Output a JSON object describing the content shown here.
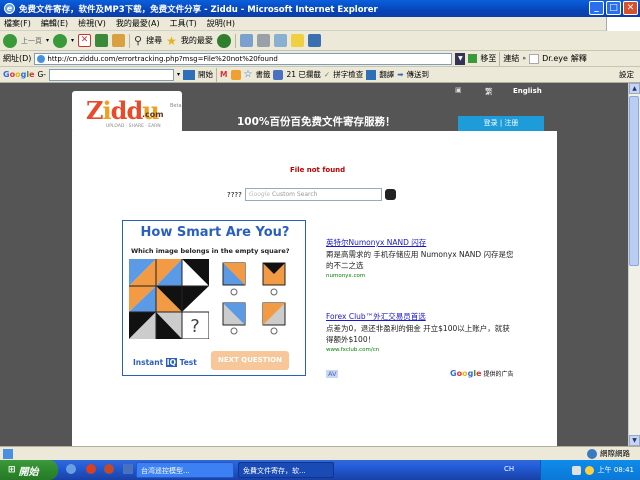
{
  "window": {
    "title": "免费文件寄存，软件及MP3下载，免费文件分享 - Ziddu - Microsoft Internet Explorer"
  },
  "menu": [
    "檔案(F)",
    "編輯(E)",
    "檢視(V)",
    "我的最愛(A)",
    "工具(T)",
    "說明(H)"
  ],
  "toolbar": {
    "back": "上一頁",
    "search": "搜尋",
    "favorites": "我的最愛"
  },
  "address": {
    "label": "網址(D)",
    "url": "http://cn.ziddu.com/errortracking.php?msg=File%20not%20found",
    "go": "移至",
    "links": "連結",
    "extra": "Dr.eye",
    "translate": "解釋"
  },
  "googlebar": {
    "logo": "Google",
    "search_label": "G-",
    "go": "開始",
    "bookmarks": "書籤",
    "blocked": "21 已攔截",
    "spellcheck": "拼字檢查",
    "translate": "翻譯",
    "sendto": "傳送到",
    "settings": "設定"
  },
  "site": {
    "lang": [
      "繁",
      "English"
    ],
    "logo_text": "Ziddu",
    "logo_beta": "Beta",
    "logo_com": ".com",
    "logo_tagline": "UPLOAD · SHARE · EARN",
    "headline": "100%百份百免费文件寄存服務！",
    "login": "登录 | 注册",
    "error": "File not found",
    "search_q": "????",
    "search_placeholder": "Custom Search",
    "search_brand": "Google"
  },
  "quiz_ad": {
    "title": "How Smart Are You?",
    "question": "Which image belongs in the empty square?",
    "brand_left": "Instant",
    "brand_iq": "IQ",
    "brand_right": "Test",
    "button": "NEXT QUESTION"
  },
  "text_ads": [
    {
      "title": "英特尔Numonyx NAND 闪存",
      "body": "兩是高需求的 手机存储应用 Numonyx NAND 闪存是您的不二之选",
      "url": "numonyx.com"
    },
    {
      "title": "Forex Club™外汇交易员首选",
      "body": "点差为0，退还非盈利的佣金 开立$100以上账户，就获得额外$100！",
      "url": "www.fxclub.com/cn"
    }
  ],
  "adchoice": "提供的广告",
  "ad_pager": "AV",
  "statusbar": {
    "zone": "網際網路"
  },
  "taskbar": {
    "start": "開始",
    "tasks": [
      "台湾遥控模型...",
      "免費文件寄存，软..."
    ],
    "clock": "上午 08:41",
    "lang": "CH"
  },
  "colors": {
    "title_blue": "#0a5fdc",
    "login_bg": "#1e9bd9",
    "error_red": "#c00000",
    "ad_link": "#1a1acc",
    "ad_url": "#008000",
    "quiz_border": "#2a5fbf",
    "quiz_orange": "#f39a44",
    "quiz_blue": "#5b9be6"
  }
}
